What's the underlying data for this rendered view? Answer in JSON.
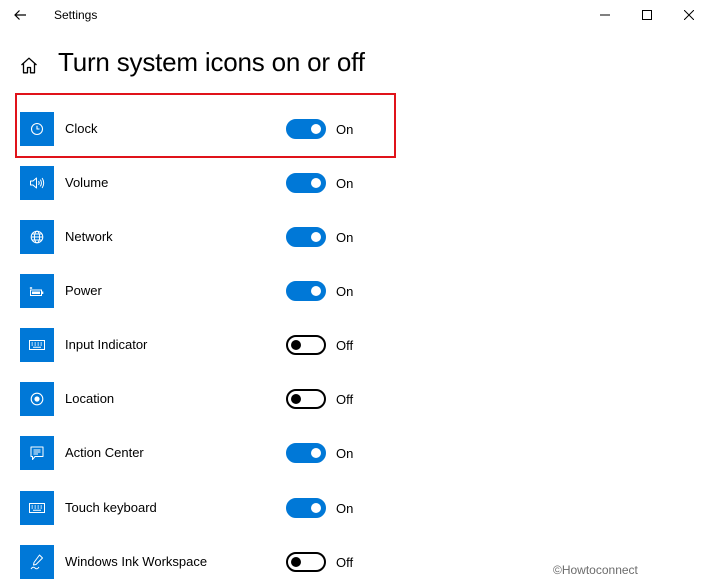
{
  "window": {
    "title": "Settings",
    "back_icon": "arrow-left-icon",
    "controls": [
      "minimize-icon",
      "maximize-icon",
      "close-icon"
    ]
  },
  "page": {
    "home_icon": "home-icon",
    "title": "Turn system icons on or off"
  },
  "colors": {
    "accent": "#0078d7",
    "highlight": "#e0131a"
  },
  "items": [
    {
      "label": "Clock",
      "icon": "clock-icon",
      "on": true,
      "state": "On"
    },
    {
      "label": "Volume",
      "icon": "volume-icon",
      "on": true,
      "state": "On"
    },
    {
      "label": "Network",
      "icon": "globe-icon",
      "on": true,
      "state": "On"
    },
    {
      "label": "Power",
      "icon": "battery-icon",
      "on": true,
      "state": "On"
    },
    {
      "label": "Input Indicator",
      "icon": "keyboard-icon",
      "on": false,
      "state": "Off"
    },
    {
      "label": "Location",
      "icon": "location-icon",
      "on": false,
      "state": "Off"
    },
    {
      "label": "Action Center",
      "icon": "action-center-icon",
      "on": true,
      "state": "On"
    },
    {
      "label": "Touch keyboard",
      "icon": "keyboard-icon",
      "on": true,
      "state": "On"
    },
    {
      "label": "Windows Ink Workspace",
      "icon": "pen-icon",
      "on": false,
      "state": "Off"
    }
  ],
  "watermark": "©Howtoconnect"
}
